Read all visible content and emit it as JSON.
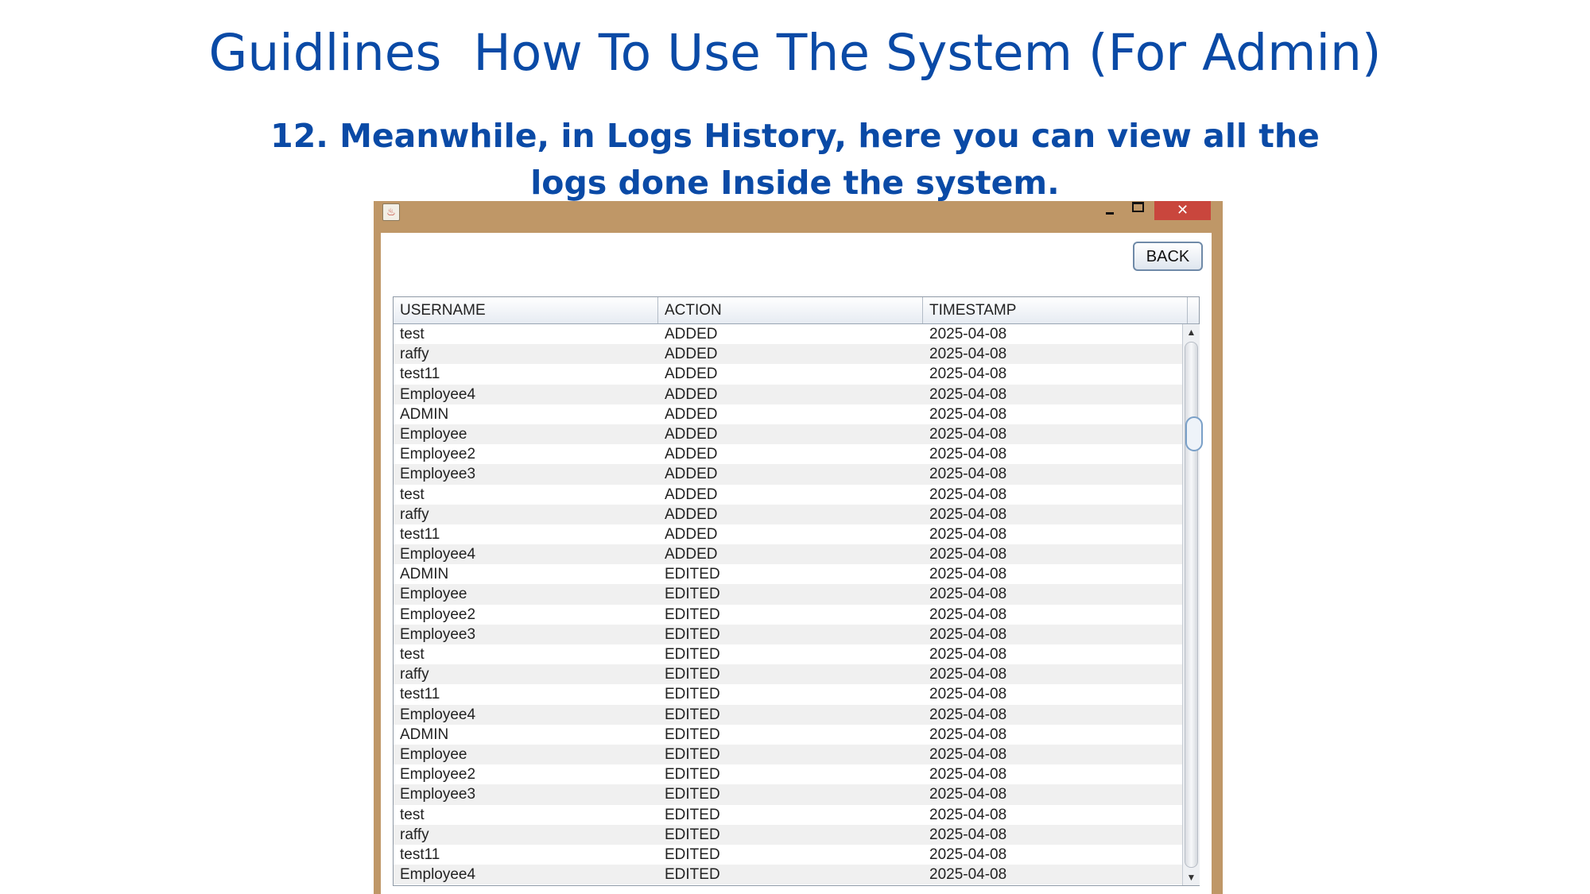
{
  "slide": {
    "title": "Guidlines  How To Use The System (For Admin)",
    "subtitle_line1": "12. Meanwhile, in Logs History, here you can view all the",
    "subtitle_line2": "logs done Inside the system."
  },
  "window": {
    "close_glyph": "✕",
    "app_icon_glyph": "♨",
    "back_label": "BACK"
  },
  "table": {
    "headers": {
      "username": "USERNAME",
      "action": "ACTION",
      "timestamp": "TIMESTAMP"
    },
    "rows": [
      {
        "username": "test",
        "action": "ADDED",
        "timestamp": "2025-04-08"
      },
      {
        "username": "raffy",
        "action": "ADDED",
        "timestamp": "2025-04-08"
      },
      {
        "username": "test11",
        "action": "ADDED",
        "timestamp": "2025-04-08"
      },
      {
        "username": "Employee4",
        "action": "ADDED",
        "timestamp": "2025-04-08"
      },
      {
        "username": "ADMIN",
        "action": "ADDED",
        "timestamp": "2025-04-08"
      },
      {
        "username": "Employee",
        "action": "ADDED",
        "timestamp": "2025-04-08"
      },
      {
        "username": "Employee2",
        "action": "ADDED",
        "timestamp": "2025-04-08"
      },
      {
        "username": "Employee3",
        "action": "ADDED",
        "timestamp": "2025-04-08"
      },
      {
        "username": "test",
        "action": "ADDED",
        "timestamp": "2025-04-08"
      },
      {
        "username": "raffy",
        "action": "ADDED",
        "timestamp": "2025-04-08"
      },
      {
        "username": "test11",
        "action": "ADDED",
        "timestamp": "2025-04-08"
      },
      {
        "username": "Employee4",
        "action": "ADDED",
        "timestamp": "2025-04-08"
      },
      {
        "username": "ADMIN",
        "action": "EDITED",
        "timestamp": "2025-04-08"
      },
      {
        "username": "Employee",
        "action": "EDITED",
        "timestamp": "2025-04-08"
      },
      {
        "username": "Employee2",
        "action": "EDITED",
        "timestamp": "2025-04-08"
      },
      {
        "username": "Employee3",
        "action": "EDITED",
        "timestamp": "2025-04-08"
      },
      {
        "username": "test",
        "action": "EDITED",
        "timestamp": "2025-04-08"
      },
      {
        "username": "raffy",
        "action": "EDITED",
        "timestamp": "2025-04-08"
      },
      {
        "username": "test11",
        "action": "EDITED",
        "timestamp": "2025-04-08"
      },
      {
        "username": "Employee4",
        "action": "EDITED",
        "timestamp": "2025-04-08"
      },
      {
        "username": "ADMIN",
        "action": "EDITED",
        "timestamp": "2025-04-08"
      },
      {
        "username": "Employee",
        "action": "EDITED",
        "timestamp": "2025-04-08"
      },
      {
        "username": "Employee2",
        "action": "EDITED",
        "timestamp": "2025-04-08"
      },
      {
        "username": "Employee3",
        "action": "EDITED",
        "timestamp": "2025-04-08"
      },
      {
        "username": "test",
        "action": "EDITED",
        "timestamp": "2025-04-08"
      },
      {
        "username": "raffy",
        "action": "EDITED",
        "timestamp": "2025-04-08"
      },
      {
        "username": "test11",
        "action": "EDITED",
        "timestamp": "2025-04-08"
      },
      {
        "username": "Employee4",
        "action": "EDITED",
        "timestamp": "2025-04-08"
      }
    ]
  },
  "scrollbar": {
    "up_glyph": "▲",
    "down_glyph": "▼"
  }
}
